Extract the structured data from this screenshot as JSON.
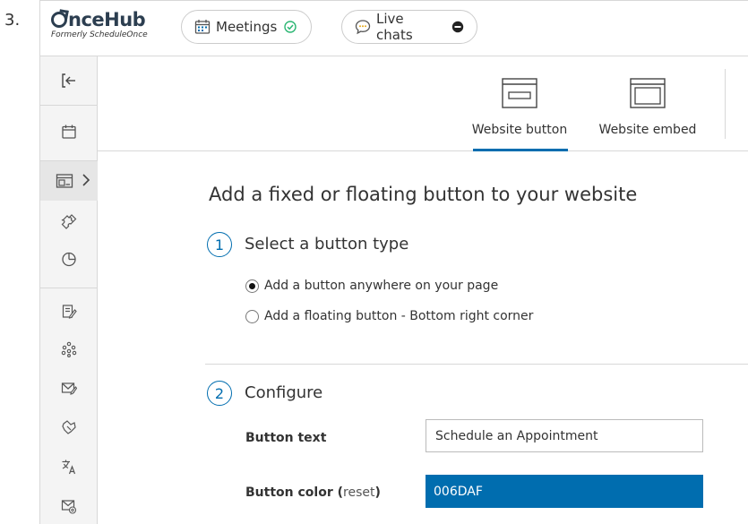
{
  "step_number": "3.",
  "brand": {
    "name": "OnceHub",
    "name_rest": "nceHub",
    "subtitle": "Formerly ScheduleOnce"
  },
  "top_pills": {
    "meetings": {
      "label": "Meetings",
      "icon": "calendar-icon",
      "status_icon": "check-circle-icon",
      "status_color": "#2bb673"
    },
    "live_chats": {
      "label": "Live chats",
      "icon": "chat-bubble-icon",
      "status_icon": "minus-circle-icon",
      "status_color": "#222222"
    }
  },
  "sidebar": {
    "items": [
      {
        "name": "exit",
        "icon": "exit-icon"
      },
      {
        "name": "calendar",
        "icon": "calendar-icon"
      },
      {
        "name": "website-widgets",
        "icon": "website-widget-icon",
        "active": true
      },
      {
        "name": "integrations",
        "icon": "puzzle-icon"
      },
      {
        "name": "reports",
        "icon": "pie-chart-icon"
      },
      {
        "name": "notes",
        "icon": "document-edit-icon"
      },
      {
        "name": "workflows",
        "icon": "network-icon"
      },
      {
        "name": "email-templates",
        "icon": "envelope-edit-icon"
      },
      {
        "name": "handshake",
        "icon": "handshake-icon"
      },
      {
        "name": "translate",
        "icon": "translate-icon"
      },
      {
        "name": "email-settings",
        "icon": "envelope-at-icon"
      }
    ]
  },
  "tabs": [
    {
      "label": "Website button",
      "icon": "website-button-icon",
      "active": true
    },
    {
      "label": "Website embed",
      "icon": "website-embed-icon",
      "active": false
    }
  ],
  "main": {
    "title": "Add a fixed or floating button to your website",
    "section1": {
      "number": "1",
      "title": "Select a button type",
      "options": [
        {
          "label": "Add a button anywhere on your page",
          "checked": true
        },
        {
          "label": "Add a floating button - Bottom right corner",
          "checked": false
        }
      ]
    },
    "section2": {
      "number": "2",
      "title": "Configure",
      "button_text_label": "Button text",
      "button_text_value": "Schedule an Appointment",
      "button_color_label": "Button color",
      "button_color_open": " (",
      "button_color_reset": "reset",
      "button_color_close": ")",
      "button_color_value": "006DAF"
    }
  },
  "colors": {
    "accent": "#006daf",
    "text": "#333333",
    "border": "#d8d8d8",
    "sidebar_bg": "#f4f4f4"
  }
}
